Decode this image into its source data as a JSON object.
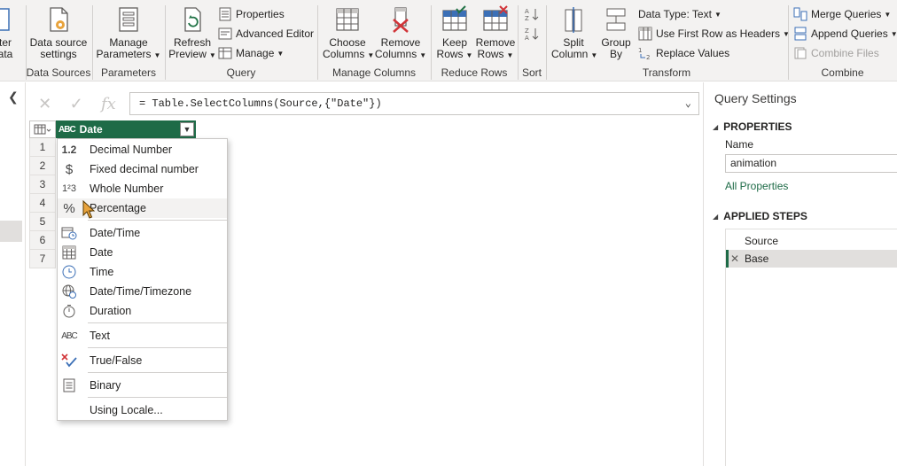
{
  "ribbon": {
    "partial_left_top": "ter",
    "partial_left_bottom": "ata",
    "data_source_settings": [
      "Data source",
      "settings"
    ],
    "manage_parameters": [
      "Manage",
      "Parameters"
    ],
    "refresh_preview": [
      "Refresh",
      "Preview"
    ],
    "properties": "Properties",
    "advanced_editor": "Advanced Editor",
    "manage": "Manage",
    "choose_columns": [
      "Choose",
      "Columns"
    ],
    "remove_columns": [
      "Remove",
      "Columns"
    ],
    "keep_rows": [
      "Keep",
      "Rows"
    ],
    "remove_rows": [
      "Remove",
      "Rows"
    ],
    "split_column": [
      "Split",
      "Column"
    ],
    "group_by": [
      "Group",
      "By"
    ],
    "data_type": "Data Type: Text",
    "use_first_row": "Use First Row as Headers",
    "replace_values": "Replace Values",
    "merge_queries": "Merge Queries",
    "append_queries": "Append Queries",
    "combine_files": "Combine Files",
    "groups": {
      "data_sources": "Data Sources",
      "parameters": "Parameters",
      "query": "Query",
      "manage_columns": "Manage Columns",
      "reduce_rows": "Reduce Rows",
      "sort": "Sort",
      "transform": "Transform",
      "combine": "Combine"
    }
  },
  "formula_bar": {
    "cancel_icon": "✕",
    "commit_icon": "✓",
    "fx_icon": "fx",
    "formula": "= Table.SelectColumns(Source,{\"Date\"})"
  },
  "grid": {
    "column_header": "Date",
    "type_glyph": "ABC",
    "rows": [
      "1",
      "2",
      "3",
      "4",
      "5",
      "6",
      "7"
    ]
  },
  "type_menu": {
    "items": [
      {
        "label": "Decimal Number",
        "icon": "1.2"
      },
      {
        "label": "Fixed decimal number",
        "icon": "$"
      },
      {
        "label": "Whole Number",
        "icon": "1²3"
      },
      {
        "label": "Percentage",
        "icon": "%"
      },
      {
        "label": "Date/Time",
        "icon": "datetime-icon"
      },
      {
        "label": "Date",
        "icon": "calendar-icon"
      },
      {
        "label": "Time",
        "icon": "clock-icon"
      },
      {
        "label": "Date/Time/Timezone",
        "icon": "globe-icon"
      },
      {
        "label": "Duration",
        "icon": "stopwatch-icon"
      },
      {
        "label": "Text",
        "icon": "ABC"
      },
      {
        "label": "True/False",
        "icon": "true-false-icon"
      },
      {
        "label": "Binary",
        "icon": "binary-icon"
      },
      {
        "label": "Using Locale...",
        "icon": ""
      }
    ]
  },
  "query_settings": {
    "title": "Query Settings",
    "properties_header": "PROPERTIES",
    "name_label": "Name",
    "name_value": "animation",
    "all_properties": "All Properties",
    "applied_steps_header": "APPLIED STEPS",
    "steps": [
      "Source",
      "Base"
    ]
  },
  "colors": {
    "accent": "#1e6b47",
    "ribbon_bg": "#f3f2f1",
    "selected_step": "#e1dfdd"
  }
}
